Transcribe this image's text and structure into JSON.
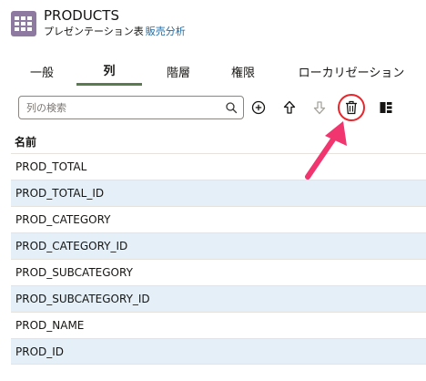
{
  "header": {
    "title": "PRODUCTS",
    "subtitle": "プレゼンテーション表",
    "subtitle_link": "販売分析"
  },
  "tabs": [
    {
      "label": "一般",
      "active": false
    },
    {
      "label": "列",
      "active": true
    },
    {
      "label": "階層",
      "active": false
    },
    {
      "label": "権限",
      "active": false
    },
    {
      "label": "ローカリゼーション",
      "active": false
    }
  ],
  "toolbar": {
    "search_placeholder": "列の検索",
    "icons": [
      "search-icon",
      "add-icon",
      "move-up-icon",
      "move-down-icon",
      "delete-icon",
      "panel-icon"
    ],
    "highlighted": "delete-icon"
  },
  "table": {
    "header": "名前",
    "rows": [
      "PROD_TOTAL",
      "PROD_TOTAL_ID",
      "PROD_CATEGORY",
      "PROD_CATEGORY_ID",
      "PROD_SUBCATEGORY",
      "PROD_SUBCATEGORY_ID",
      "PROD_NAME",
      "PROD_ID"
    ]
  },
  "colors": {
    "accent_tab": "#5a7a4f",
    "link": "#1a6ba8",
    "row_alt": "#e4eff7",
    "highlight": "#e8262c",
    "arrow": "#f0356f",
    "table_icon": "#8e79a0"
  }
}
